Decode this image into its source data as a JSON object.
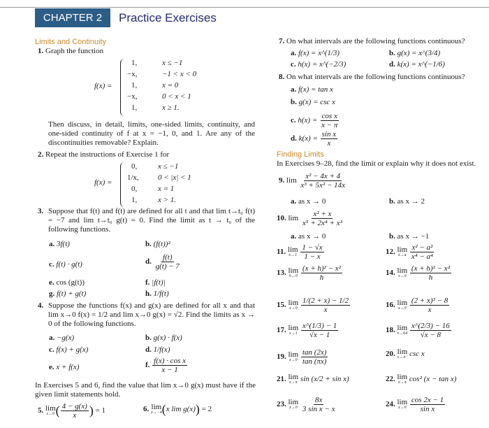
{
  "header": {
    "chapter_label": "CHAPTER 2",
    "title": "Practice Exercises",
    "chapter_box_color": "#2b5d86",
    "title_color": "#232a6e",
    "section_color": "#c98a2e"
  },
  "left": {
    "section1": "Limits and Continuity",
    "ex1": {
      "num": "1.",
      "text": "Graph the function",
      "lhs": "f(x) =",
      "cases": [
        {
          "expr": "1,",
          "cond": "x ≤ −1"
        },
        {
          "expr": "−x,",
          "cond": "−1 < x < 0"
        },
        {
          "expr": "1,",
          "cond": "x = 0"
        },
        {
          "expr": "−x,",
          "cond": "0 < x < 1"
        },
        {
          "expr": "1,",
          "cond": "x ≥ 1."
        }
      ],
      "discuss": "Then discuss, in detail, limits, one-sided limits, continuity, and one-sided continuity of f at x = −1, 0, and 1. Are any of the discontinuities removable? Explain."
    },
    "ex2": {
      "num": "2.",
      "text": "Repeat the instructions of Exercise 1 for",
      "lhs": "f(x) =",
      "cases": [
        {
          "expr": "0,",
          "cond": "x ≤ −1"
        },
        {
          "expr": "1/x,",
          "cond": "0 < |x| < 1"
        },
        {
          "expr": "0,",
          "cond": "x = 1"
        },
        {
          "expr": "1,",
          "cond": "x > 1."
        }
      ]
    },
    "ex3": {
      "num": "3.",
      "text": "Suppose that f(t) and f(t) are defined for all t and that lim t→t₀ f(t) = −7 and lim t→t₀ g(t) = 0. Find the limit as t → t₀ of the following functions.",
      "parts": [
        {
          "label": "a.",
          "expr": "3f(t)"
        },
        {
          "label": "b.",
          "expr": "(f(t))²"
        },
        {
          "label": "c.",
          "expr": "f(t) · g(t)"
        },
        {
          "label": "d.",
          "num": "f(t)",
          "den": "g(t) − 7"
        },
        {
          "label": "e.",
          "expr": "cos (g(t))"
        },
        {
          "label": "f.",
          "expr": "|f(t)|"
        },
        {
          "label": "g.",
          "expr": "f(t) + g(t)"
        },
        {
          "label": "h.",
          "expr": "1/f(t)"
        }
      ]
    },
    "ex4": {
      "num": "4.",
      "text": "Suppose the functions f(x) and g(x) are defined for all x and that lim x→0 f(x) = 1/2 and lim x→0 g(x) = √2. Find the limits as x → 0 of the following functions.",
      "parts": [
        {
          "label": "a.",
          "expr": "−g(x)"
        },
        {
          "label": "b.",
          "expr": "g(x) · f(x)"
        },
        {
          "label": "c.",
          "expr": "f(x) + g(x)"
        },
        {
          "label": "d.",
          "expr": "1/f(x)"
        },
        {
          "label": "e.",
          "expr": "x + f(x)"
        },
        {
          "label": "f.",
          "num": "f(x) · cos x",
          "den": "x − 1"
        }
      ]
    },
    "intro56": "In Exercises 5 and 6, find the value that lim x→0 g(x) must have if the given limit statements hold.",
    "ex5": {
      "num": "5.",
      "lim": "lim",
      "sub": "x→0",
      "frac_num": "4 − g(x)",
      "frac_den": "x",
      "rhs": "= 1"
    },
    "ex6": {
      "num": "6.",
      "lim": "lim",
      "sub": "x→−4",
      "inner": "x lim g(x)",
      "inner_sub": "x→0",
      "rhs": "= 2"
    }
  },
  "right": {
    "ex7": {
      "num": "7.",
      "text": "On what intervals are the following functions continuous?",
      "parts": [
        {
          "label": "a.",
          "expr": "f(x) = x^(1/3)"
        },
        {
          "label": "b.",
          "expr": "g(x) = x^(3/4)"
        },
        {
          "label": "c.",
          "expr": "h(x) = x^(−2/3)"
        },
        {
          "label": "d.",
          "expr": "k(x) = x^(−1/6)"
        }
      ]
    },
    "ex8": {
      "num": "8.",
      "text": "On what intervals are the following functions continuous?",
      "parts": [
        {
          "label": "a.",
          "expr": "f(x) = tan x"
        },
        {
          "label": "b.",
          "expr": "g(x) = csc x"
        },
        {
          "label": "c.",
          "lhs": "h(x) =",
          "num": "cos x",
          "den": "x − π"
        },
        {
          "label": "d.",
          "lhs": "k(x) =",
          "num": "sin x",
          "den": "x"
        }
      ]
    },
    "section2": "Finding Limits",
    "intro": "In Exercises 9–28, find the limit or explain why it does not exist.",
    "ex9": {
      "num": "9.",
      "lim": "lim",
      "frac_num": "x² − 4x + 4",
      "frac_den": "x³ + 5x² − 14x",
      "a": "as x → 0",
      "b": "as x → 2"
    },
    "ex10": {
      "num": "10.",
      "lim": "lim",
      "frac_num": "x² + x",
      "frac_den": "x⁵ + 2x⁴ + x³",
      "a": "as x → 0",
      "b": "as x → −1"
    },
    "limits": [
      {
        "num": "11.",
        "sub": "x→1",
        "frac_num": "1 − √x",
        "frac_den": "1 − x"
      },
      {
        "num": "12.",
        "sub": "x→a",
        "frac_num": "x² − a²",
        "frac_den": "x⁴ − a⁴"
      },
      {
        "num": "13.",
        "sub": "h→0",
        "frac_num": "(x + h)² − x²",
        "frac_den": "h"
      },
      {
        "num": "14.",
        "sub": "x→0",
        "frac_num": "(x + h)² − x²",
        "frac_den": "h"
      },
      {
        "num": "15.",
        "sub": "x→0",
        "frac_num": "1/(2 + x) − 1/2",
        "frac_den": "x"
      },
      {
        "num": "16.",
        "sub": "x→0",
        "frac_num": "(2 + x)³ − 8",
        "frac_den": "x"
      },
      {
        "num": "17.",
        "sub": "x→1",
        "frac_num": "x^(1/3) − 1",
        "frac_den": "√x − 1"
      },
      {
        "num": "18.",
        "sub": "x→64",
        "frac_num": "x^(2/3) − 16",
        "frac_den": "√x − 8"
      },
      {
        "num": "19.",
        "sub": "x→0",
        "frac_num": "tan (2x)",
        "frac_den": "tan (πx)"
      },
      {
        "num": "20.",
        "sub": "x→π⁻",
        "expr": "csc x"
      },
      {
        "num": "21.",
        "sub": "x→π",
        "expr": "sin (x/2 + sin x)"
      },
      {
        "num": "22.",
        "sub": "x→π",
        "expr": "cos² (x − tan x)"
      },
      {
        "num": "23.",
        "sub": "x→0",
        "frac_num": "8x",
        "frac_den": "3 sin x − x"
      },
      {
        "num": "24.",
        "sub": "x→0",
        "frac_num": "cos 2x − 1",
        "frac_den": "sin x"
      }
    ],
    "lim_word": "lim"
  }
}
